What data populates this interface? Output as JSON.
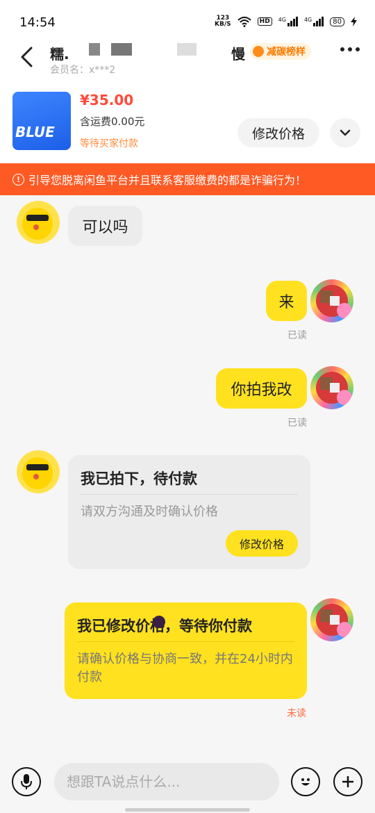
{
  "status_bar": {
    "time": "14:54",
    "net_speed_value": "123",
    "net_speed_unit": "KB/S",
    "hd": "HD",
    "signal1": "4G",
    "signal2": "4G",
    "battery": "80"
  },
  "header": {
    "name": "糯.",
    "member_label": "会员名：x***2",
    "badge_label": "减碳榜样",
    "name_tail": "慢"
  },
  "product": {
    "image_text": "BLUE",
    "price": "¥35.00",
    "shipping": "含运费0.00元",
    "status": "等待买家付款",
    "modify_price_label": "修改价格"
  },
  "warning": {
    "text": "引导您脱离闲鱼平台并且联系客服缴费的都是诈骗行为！"
  },
  "messages": [
    {
      "text": "可以吗"
    },
    {
      "text": "来",
      "receipt": "已读"
    },
    {
      "text": "你拍我改",
      "receipt": "已读"
    }
  ],
  "card_buyer": {
    "title": "我已拍下，待付款",
    "subtitle": "请双方沟通及时确认价格",
    "button_label": "修改价格"
  },
  "card_seller": {
    "title": "我已修改价格，等待你付款",
    "subtitle": "请确认价格与协商一致，并在24小时内付款",
    "receipt": "未读"
  },
  "input_bar": {
    "placeholder": "想跟TA说点什么..."
  },
  "colors": {
    "accent_yellow": "#ffe11f",
    "warning_orange": "#ff5a24",
    "price_red": "#ff4a3a"
  },
  "icons": [
    "back-arrow-icon",
    "more-icon",
    "chevron-down-icon",
    "warning-icon",
    "microphone-icon",
    "emoji-icon",
    "plus-icon"
  ]
}
